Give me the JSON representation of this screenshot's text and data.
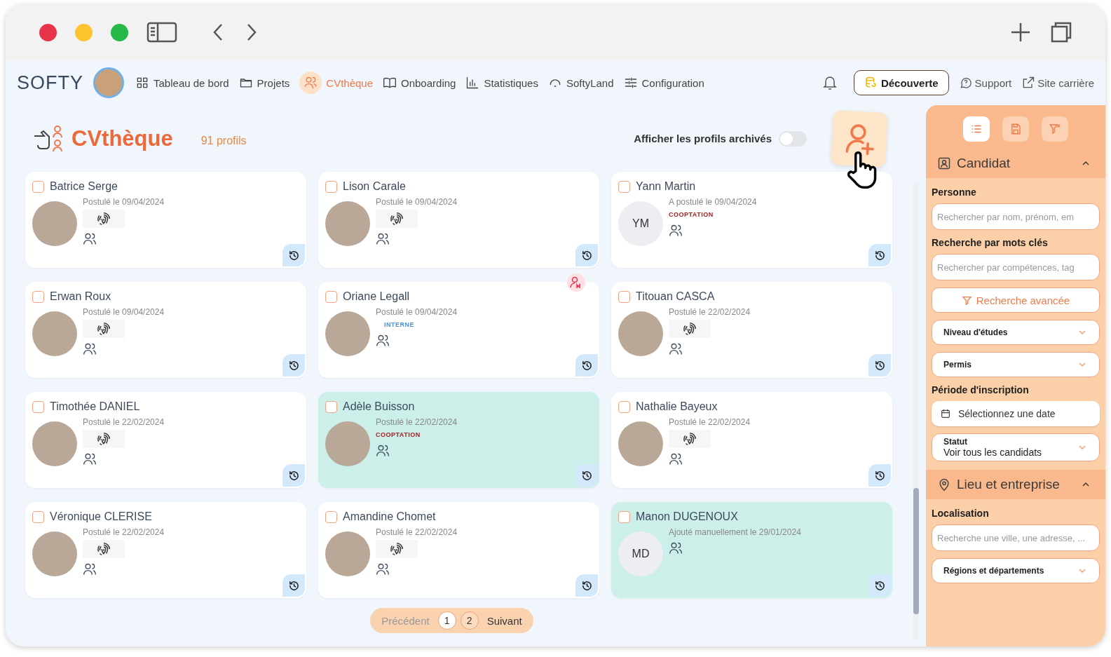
{
  "nav": {
    "logo": "SOFTY",
    "items": [
      {
        "label": "Tableau de bord",
        "selected": false
      },
      {
        "label": "Projets",
        "selected": false
      },
      {
        "label": "CVthèque",
        "selected": true
      },
      {
        "label": "Onboarding",
        "selected": false
      },
      {
        "label": "Statistiques",
        "selected": false
      },
      {
        "label": "SoftyLand",
        "selected": false
      },
      {
        "label": "Configuration",
        "selected": false
      }
    ],
    "discover_button": "Découverte",
    "links": [
      "Support",
      "Site carrière"
    ]
  },
  "header": {
    "title": "CVthèque",
    "count": "91 profils",
    "archived_toggle": {
      "label": "Afficher les profils archivés",
      "on": false
    }
  },
  "cards": [
    {
      "name": "Batrice Serge",
      "checked": false,
      "highlighted": false,
      "avatar": {
        "kind": "photo"
      },
      "date": "Postulé le 09/04/2024",
      "fingerprint": true,
      "badge": false
    },
    {
      "name": "Lison Carale",
      "checked": false,
      "highlighted": false,
      "avatar": {
        "kind": "photo"
      },
      "date": "Postulé le 09/04/2024",
      "fingerprint": true,
      "badge": false
    },
    {
      "name": "Yann Martin",
      "checked": false,
      "highlighted": false,
      "avatar": {
        "kind": "initials",
        "text": "YM"
      },
      "date": "A postulé le 09/04/2024",
      "tag": {
        "text": "COOPTATION",
        "kind": "cooptation"
      },
      "fingerprint": false,
      "badge": false
    },
    {
      "name": "Erwan Roux",
      "checked": false,
      "highlighted": false,
      "avatar": {
        "kind": "photo"
      },
      "date": "Postulé le 09/04/2024",
      "fingerprint": true,
      "badge": false
    },
    {
      "name": "Oriane Legall",
      "checked": false,
      "highlighted": false,
      "avatar": {
        "kind": "photo"
      },
      "date": "Postulé le 09/04/2024",
      "tag": {
        "text": "INTERNE",
        "kind": "internal"
      },
      "fingerprint": false,
      "badge": true
    },
    {
      "name": "Titouan CASCA",
      "checked": false,
      "highlighted": false,
      "avatar": {
        "kind": "photo"
      },
      "date": "Postulé le 22/02/2024",
      "fingerprint": true,
      "badge": false
    },
    {
      "name": "Timothée DANIEL",
      "checked": false,
      "highlighted": false,
      "avatar": {
        "kind": "photo"
      },
      "date": "Postulé le 22/02/2024",
      "fingerprint": true,
      "badge": false
    },
    {
      "name": "Adèle Buisson",
      "checked": false,
      "highlighted": true,
      "avatar": {
        "kind": "photo"
      },
      "date": "Postulé le 22/02/2024",
      "tag": {
        "text": "COOPTATION",
        "kind": "cooptation"
      },
      "fingerprint": false,
      "badge": false
    },
    {
      "name": "Nathalie Bayeux",
      "checked": false,
      "highlighted": false,
      "avatar": {
        "kind": "photo"
      },
      "date": "Postulé le 22/02/2024",
      "fingerprint": true,
      "badge": false
    },
    {
      "name": "Véronique CLERISE",
      "checked": false,
      "highlighted": false,
      "avatar": {
        "kind": "photo"
      },
      "date": "Postulé le 22/02/2024",
      "fingerprint": true,
      "badge": false
    },
    {
      "name": "Amandine Chomet",
      "checked": false,
      "highlighted": false,
      "avatar": {
        "kind": "photo"
      },
      "date": "Postulé le 22/02/2024",
      "fingerprint": true,
      "badge": false
    },
    {
      "name": "Manon DUGENOUX",
      "checked": false,
      "highlighted": true,
      "avatar": {
        "kind": "initials",
        "text": "MD"
      },
      "date": "Ajouté manuellement le 29/01/2024",
      "fingerprint": false,
      "badge": false
    }
  ],
  "pagination": {
    "previous": {
      "label": "Précédent",
      "disabled": true
    },
    "pages": [
      {
        "label": "1",
        "selected": true
      },
      {
        "label": "2",
        "selected": false
      }
    ],
    "next": {
      "label": "Suivant",
      "disabled": false
    }
  },
  "sidebar": {
    "tools": [
      {
        "selected": true
      },
      {
        "selected": false
      },
      {
        "selected": false
      }
    ],
    "sections": [
      {
        "title": "Candidat",
        "expanded": true,
        "fields": [
          {
            "kind": "label",
            "text": "Personne"
          },
          {
            "kind": "input",
            "placeholder": "Rechercher par nom, prénom, em"
          },
          {
            "kind": "label",
            "text": "Recherche par mots clés"
          },
          {
            "kind": "input",
            "placeholder": "Rechercher par compétences, tag"
          },
          {
            "kind": "button",
            "text": "Recherche avancée"
          },
          {
            "kind": "select",
            "text": "Niveau d'études"
          },
          {
            "kind": "select",
            "text": "Permis"
          },
          {
            "kind": "label",
            "text": "Période d'inscription"
          },
          {
            "kind": "date",
            "placeholder": "Sélectionnez une date"
          },
          {
            "kind": "select",
            "text": "Statut",
            "value": "Voir tous les candidats"
          }
        ]
      },
      {
        "title": "Lieu et entreprise",
        "expanded": true,
        "fields": [
          {
            "kind": "label",
            "text": "Localisation"
          },
          {
            "kind": "input",
            "placeholder": "Recherche une ville, une adresse, ..."
          },
          {
            "kind": "select",
            "text": "Régions et départements"
          }
        ]
      }
    ]
  }
}
